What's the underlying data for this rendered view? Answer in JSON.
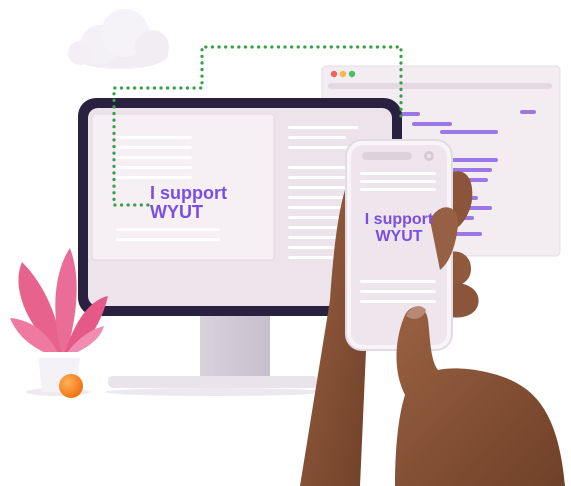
{
  "monitor_screen": {
    "headline_line1": "I support",
    "headline_line2": "WYUT"
  },
  "phone_screen": {
    "headline_line1": "I support",
    "headline_line2": "WYUT"
  },
  "colors": {
    "accent_text": "#7a4fe0",
    "monitor_frame": "#2a2140",
    "screen_bg": "#ece4ea",
    "card_bg": "#f5eef3",
    "dotted_line": "#3aa047",
    "browser_dot_red": "#f0645a",
    "browser_dot_yellow": "#f7b84b",
    "browser_dot_green": "#4cc061",
    "code_lines": "#9b78e6",
    "plant_leaves": "#e8628e",
    "orange_ball": "#f38a24",
    "skin": "#8a5538"
  },
  "icons": {
    "phone_settings": "gear-icon",
    "cloud": "cloud-icon"
  }
}
